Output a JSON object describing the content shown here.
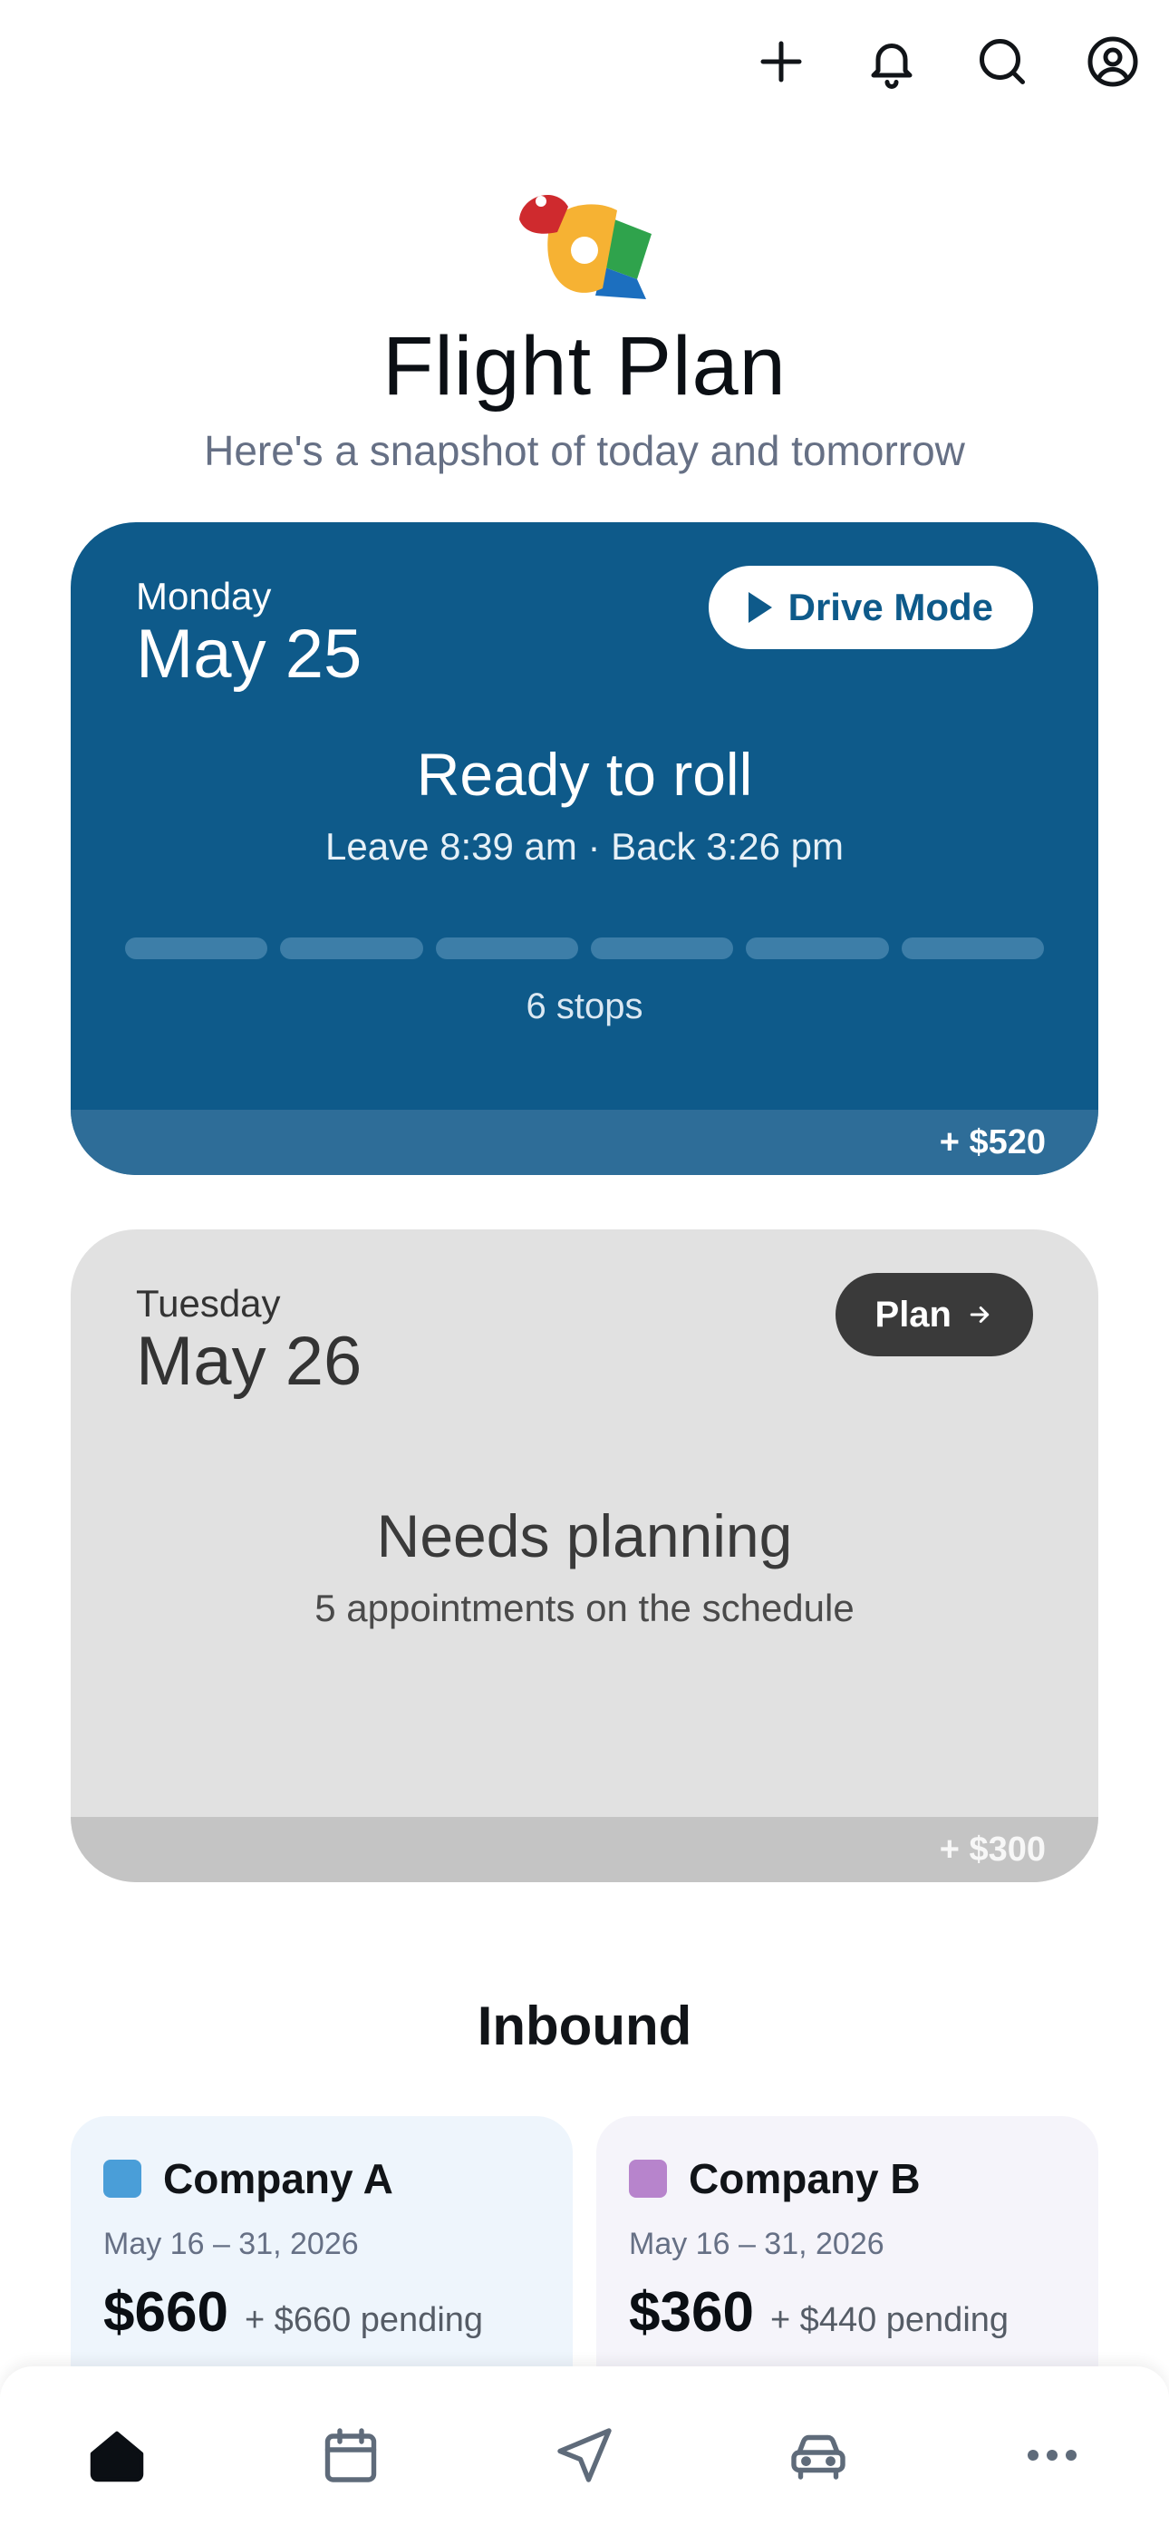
{
  "topbar": {
    "icons": [
      "plus-icon",
      "bell-icon",
      "search-icon",
      "user-circle-icon"
    ]
  },
  "header": {
    "title": "Flight Plan",
    "subtitle": "Here's a snapshot of today and tomorrow"
  },
  "today": {
    "weekday": "Monday",
    "date": "May 25",
    "action_label": "Drive Mode",
    "status": "Ready to roll",
    "times": "Leave 8:39 am · Back 3:26 pm",
    "stops_label": "6 stops",
    "earnings": "+ $520",
    "color": "#0e5a8a"
  },
  "tomorrow": {
    "weekday": "Tuesday",
    "date": "May 26",
    "action_label": "Plan",
    "status": "Needs planning",
    "detail": "5 appointments on the schedule",
    "earnings": "+ $300"
  },
  "inbound": {
    "title": "Inbound",
    "companies": [
      {
        "name": "Company A",
        "range": "May 16 – 31, 2026",
        "amount": "$660",
        "pending": "+ $660 pending",
        "color": "#4a9ed8"
      },
      {
        "name": "Company B",
        "range": "May 16 – 31, 2026",
        "amount": "$360",
        "pending": "+ $440 pending",
        "color": "#b784cc"
      }
    ]
  },
  "bottom_nav": {
    "items": [
      "home-icon",
      "calendar-icon",
      "navigation-icon",
      "car-icon",
      "more-icon"
    ],
    "active": "home-icon"
  }
}
